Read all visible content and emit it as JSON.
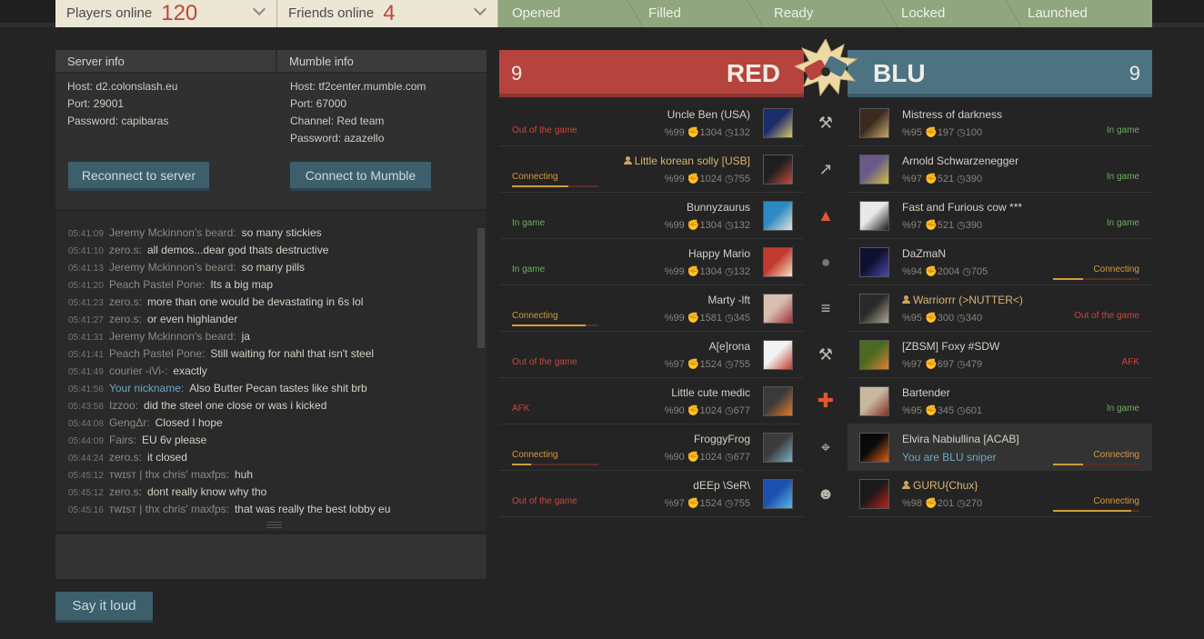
{
  "topbar": {
    "players_label": "Players online",
    "players_count": "120",
    "friends_label": "Friends online",
    "friends_count": "4",
    "stages": [
      "Opened",
      "Filled",
      "Ready",
      "Locked",
      "Launched"
    ]
  },
  "server_info": {
    "title": "Server info",
    "host": "Host: d2.colonslash.eu",
    "port": "Port: 29001",
    "password": "Password: capibaras",
    "button": "Reconnect to server"
  },
  "mumble_info": {
    "title": "Mumble info",
    "host": "Host: tf2center.mumble.com",
    "port": "Port: 67000",
    "channel": "Channel: Red team",
    "password": "Password: azazello",
    "button": "Connect to Mumble"
  },
  "chat": {
    "messages": [
      {
        "time": "05:41:09",
        "nick": "Jeremy Mckinnon's beard:",
        "text": "so many stickies"
      },
      {
        "time": "05:41:10",
        "nick": "zero.s:",
        "text": "all demos...dear god thats destructive"
      },
      {
        "time": "05:41:13",
        "nick": "Jeremy Mckinnon's beard:",
        "text": "so many pills"
      },
      {
        "time": "05:41:20",
        "nick": "Peach Pastel Pone:",
        "text": "Its a big map"
      },
      {
        "time": "05:41:23",
        "nick": "zero.s:",
        "text": "more than one would be devastating in 6s lol"
      },
      {
        "time": "05:41:27",
        "nick": "zero.s:",
        "text": "or even highlander"
      },
      {
        "time": "05:41:31",
        "nick": "Jeremy Mckinnon's beard:",
        "text": "ja"
      },
      {
        "time": "05:41:41",
        "nick": "Peach Pastel Pone:",
        "text": "Still waiting for nahl that isn't steel"
      },
      {
        "time": "05:41:49",
        "nick": "courier -iVi-:",
        "text": "exactly"
      },
      {
        "time": "05:41:56",
        "nick": "Your nickname:",
        "text": "Also Butter Pecan tastes like shit brb"
      },
      {
        "time": "05:43:58",
        "nick": "Izzoo:",
        "text": "did the steel one close or was i kicked"
      },
      {
        "time": "05:44:08",
        "nick": "GengΔr:",
        "text": "Closed I hope"
      },
      {
        "time": "05:44:09",
        "nick": "Fairs:",
        "text": "EU 6v please"
      },
      {
        "time": "05:44:24",
        "nick": "zero.s:",
        "text": "it closed"
      },
      {
        "time": "05:45:12",
        "nick": "ᴛᴡɪsᴛ | thx chris' maxfps:",
        "text": "huh"
      },
      {
        "time": "05:45:12",
        "nick": "zero.s:",
        "text": "dont really know why tho"
      },
      {
        "time": "05:45:16",
        "nick": "ᴛᴡɪsᴛ | thx chris' maxfps:",
        "text": "that was really the best lobby eu"
      }
    ],
    "say_button": "Say it loud"
  },
  "red": {
    "count": "9",
    "name": "RED",
    "players": [
      {
        "name": "Uncle Ben (USA)",
        "status": "Out of the game",
        "percent": "99",
        "games": "1304",
        "hours": "132",
        "progress": 0
      },
      {
        "name": "Little korean solly [USB]",
        "status": "Connecting",
        "percent": "99",
        "games": "1024",
        "hours": "755",
        "progress": 0.65
      },
      {
        "name": "Bunnyzaurus",
        "status": "In game",
        "percent": "99",
        "games": "1304",
        "hours": "132",
        "progress": 0
      },
      {
        "name": "Happy Mario",
        "status": "In game",
        "percent": "99",
        "games": "1304",
        "hours": "132",
        "progress": 0
      },
      {
        "name": "Marty -lft",
        "status": "Connecting",
        "percent": "99",
        "games": "1581",
        "hours": "345",
        "progress": 0.85
      },
      {
        "name": "A[e]rona",
        "status": "Out of the game",
        "percent": "97",
        "games": "1524",
        "hours": "755",
        "progress": 0
      },
      {
        "name": "Little cute medic",
        "status": "AFK",
        "percent": "90",
        "games": "1024",
        "hours": "677",
        "progress": 0
      },
      {
        "name": "FroggyFrog",
        "status": "Connecting",
        "percent": "90",
        "games": "1024",
        "hours": "677",
        "progress": 0.22
      },
      {
        "name": "dEEp \\SeR\\",
        "status": "Out of the game",
        "percent": "97",
        "games": "1524",
        "hours": "755",
        "progress": 0
      }
    ]
  },
  "blu": {
    "count": "9",
    "name": "BLU",
    "players": [
      {
        "name": "Mistress of darkness",
        "status": "In game",
        "percent": "95",
        "games": "197",
        "hours": "100",
        "progress": 0
      },
      {
        "name": "Arnold Schwarzenegger",
        "status": "In game",
        "percent": "97",
        "games": "521",
        "hours": "390",
        "progress": 0
      },
      {
        "name": "Fast and Furious cow ***",
        "status": "In game",
        "percent": "97",
        "games": "521",
        "hours": "390",
        "progress": 0
      },
      {
        "name": "DaZmaN",
        "status": "Connecting",
        "percent": "94",
        "games": "2004",
        "hours": "705",
        "progress": 0.35
      },
      {
        "name": "Warriorrr (>NUTTER<)",
        "status": "Out of the game",
        "percent": "95",
        "games": "300",
        "hours": "340",
        "progress": 0
      },
      {
        "name": "[ZBSM] Foxy #SDW",
        "status": "AFK",
        "percent": "97",
        "games": "697",
        "hours": "479",
        "progress": 0
      },
      {
        "name": "Bartender",
        "status": "In game",
        "percent": "95",
        "games": "345",
        "hours": "601",
        "progress": 0
      },
      {
        "name": "Elvira Nabiullina [ACAB]",
        "status": "Connecting",
        "percent": "",
        "games": "",
        "hours": "",
        "progress": 0.35,
        "self_text": "You are BLU sniper"
      },
      {
        "name": "GURU{Chux}",
        "status": "Connecting",
        "percent": "98",
        "games": "201",
        "hours": "270",
        "progress": 0.9
      }
    ]
  },
  "colors": {
    "red_team": "#b6433d",
    "blu_team": "#4d7383",
    "stage_bar": "#8fa67f",
    "topbar": "#ece6d5",
    "button": "#3d5f6b",
    "status_red": "#c9473d",
    "status_green": "#6fae5f",
    "status_orange": "#d29b3f"
  }
}
